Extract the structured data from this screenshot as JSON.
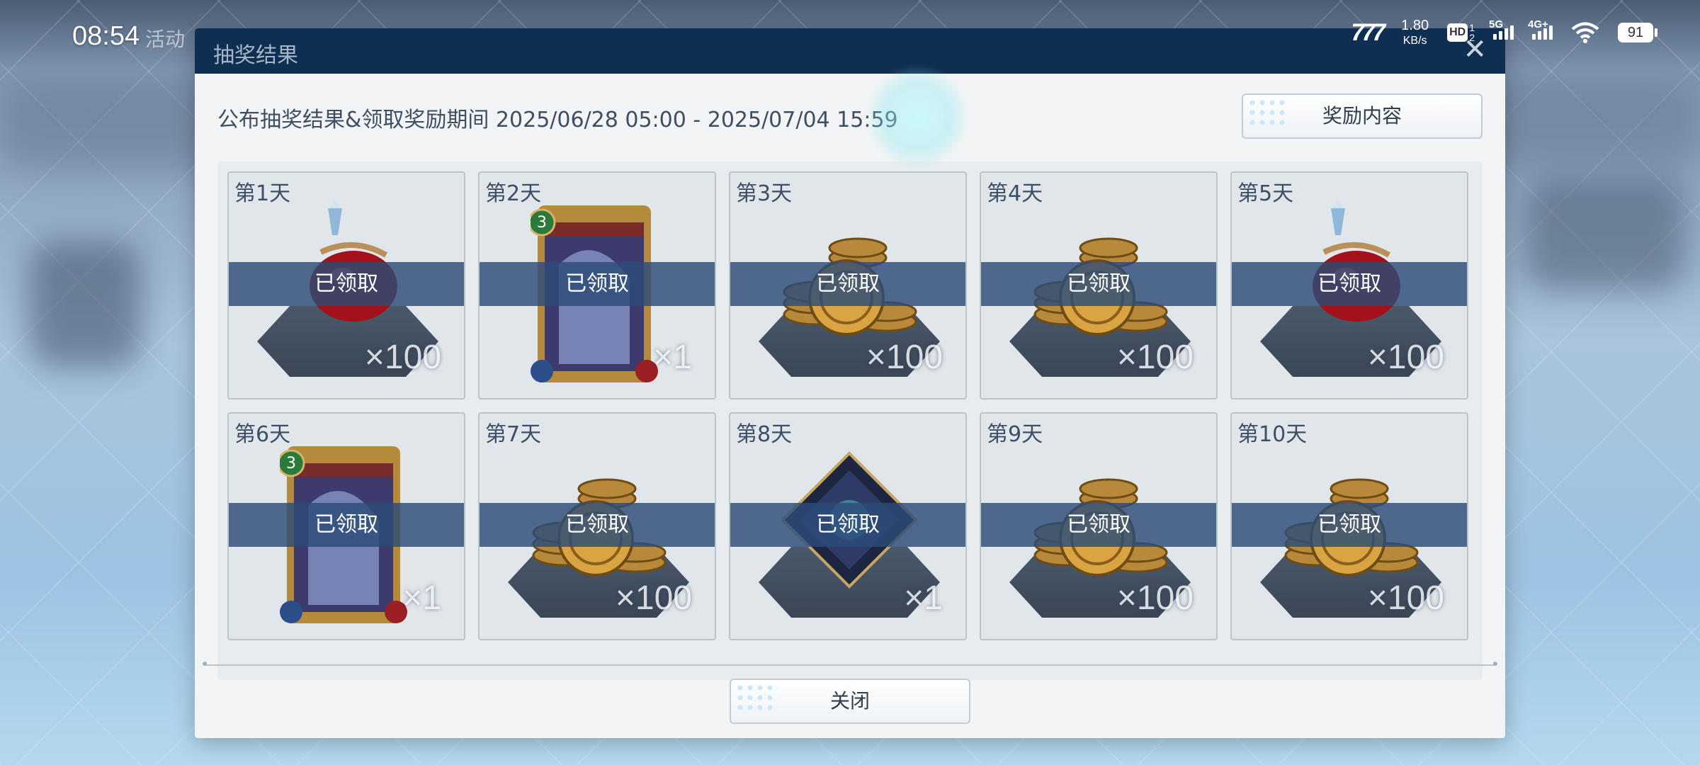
{
  "status_bar": {
    "time": "08:54",
    "background_game_text": "活动",
    "carrier_logo": "777",
    "net_speed_value": "1.80",
    "net_speed_unit": "KB/s",
    "hd_label": "HD",
    "hd_sim": [
      "1",
      "2"
    ],
    "signal_1_label": "5G",
    "signal_2_label": "4G+",
    "battery": "91"
  },
  "dialog": {
    "title": "抽奖结果",
    "close_icon": "close-icon",
    "period_text": "公布抽奖结果&领取奖励期间 2025/06/28 05:00 - 2025/07/04 15:59",
    "reward_button": "奖励内容",
    "close_button": "关闭",
    "claimed_text": "已领取",
    "cells": [
      {
        "day": "第1天",
        "item": "potion",
        "qty": "×100"
      },
      {
        "day": "第2天",
        "item": "card",
        "qty": "×1"
      },
      {
        "day": "第3天",
        "item": "coins",
        "qty": "×100"
      },
      {
        "day": "第4天",
        "item": "coins",
        "qty": "×100"
      },
      {
        "day": "第5天",
        "item": "potion",
        "qty": "×100"
      },
      {
        "day": "第6天",
        "item": "card",
        "qty": "×1"
      },
      {
        "day": "第7天",
        "item": "coins",
        "qty": "×100"
      },
      {
        "day": "第8天",
        "item": "diamond-emblem",
        "qty": "×1"
      },
      {
        "day": "第9天",
        "item": "coins",
        "qty": "×100"
      },
      {
        "day": "第10天",
        "item": "coins",
        "qty": "×100"
      }
    ]
  }
}
